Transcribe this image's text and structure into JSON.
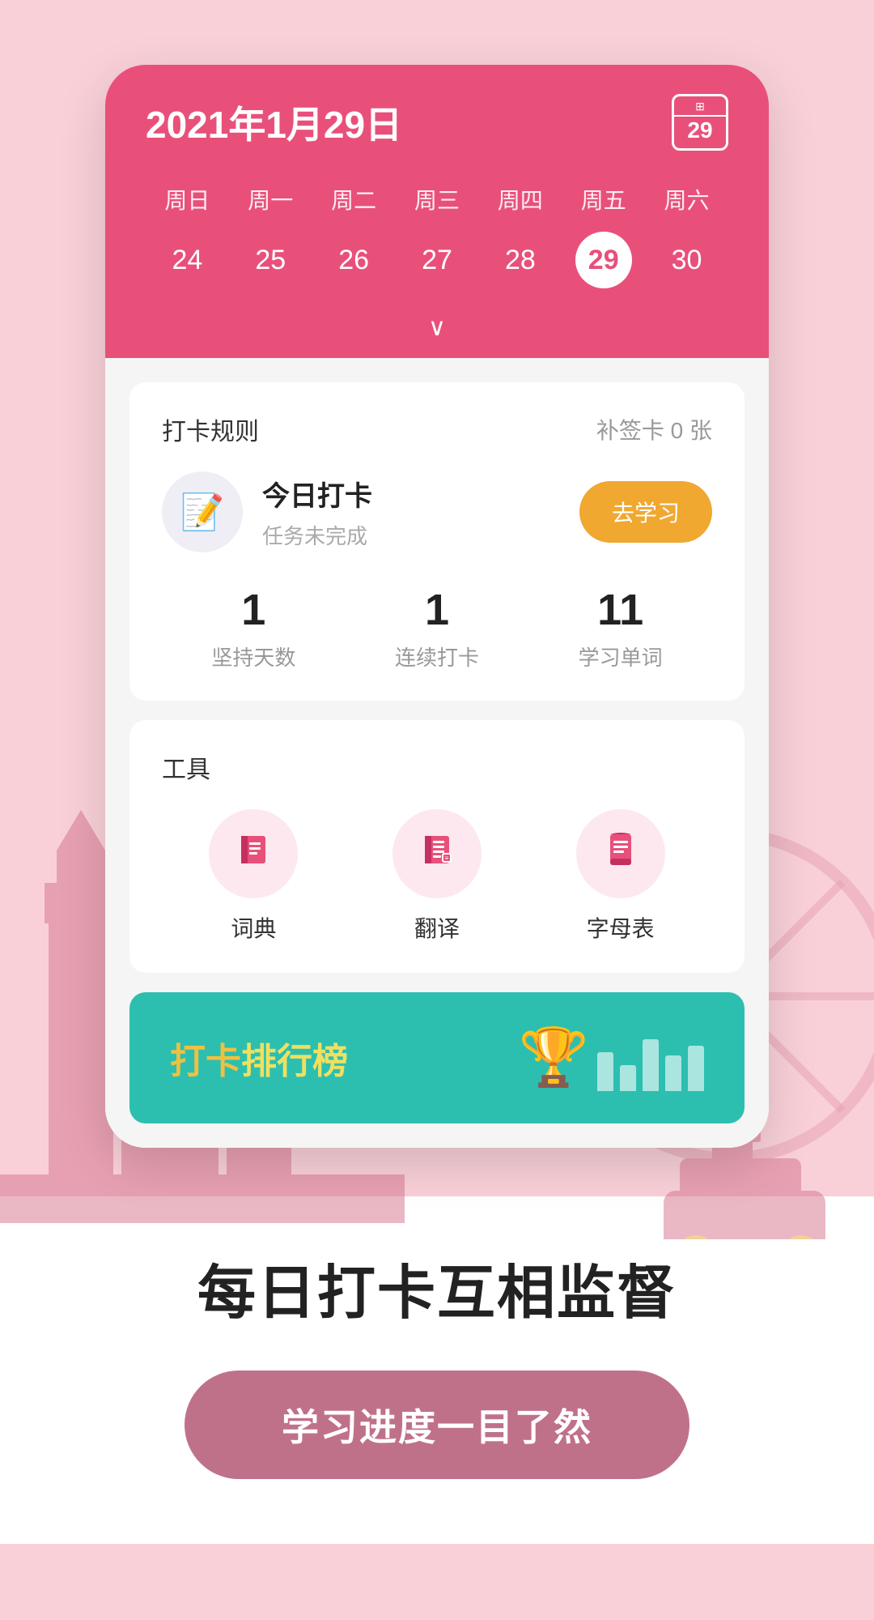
{
  "app": {
    "bg_color": "#f9d0d8"
  },
  "calendar": {
    "title": "2021年1月29日",
    "icon_num": "29",
    "weekdays": [
      "周日",
      "周一",
      "周二",
      "周三",
      "周四",
      "周五",
      "周六"
    ],
    "dates": [
      "24",
      "25",
      "26",
      "27",
      "28",
      "29",
      "30"
    ],
    "active_date": "29",
    "chevron": "∨"
  },
  "checkin_card": {
    "label": "打卡规则",
    "supplement": "补签卡 0 张",
    "task_title": "今日打卡",
    "task_subtitle": "任务未完成",
    "go_study_label": "去学习",
    "stats": [
      {
        "number": "1",
        "label": "坚持天数"
      },
      {
        "number": "1",
        "label": "连续打卡"
      },
      {
        "number": "11",
        "label": "学习单词"
      }
    ]
  },
  "tools_card": {
    "label": "工具",
    "tools": [
      {
        "name": "词典",
        "icon": "📖"
      },
      {
        "name": "翻译",
        "icon": "📋"
      },
      {
        "name": "字母表",
        "icon": "📄"
      }
    ]
  },
  "ranking": {
    "text_plain": "打卡",
    "text_highlight": "排行榜",
    "trophy": "🏆",
    "bars": [
      60,
      40,
      80
    ]
  },
  "bottom": {
    "tagline": "每日打卡互相监督",
    "cta": "学习进度一目了然"
  }
}
